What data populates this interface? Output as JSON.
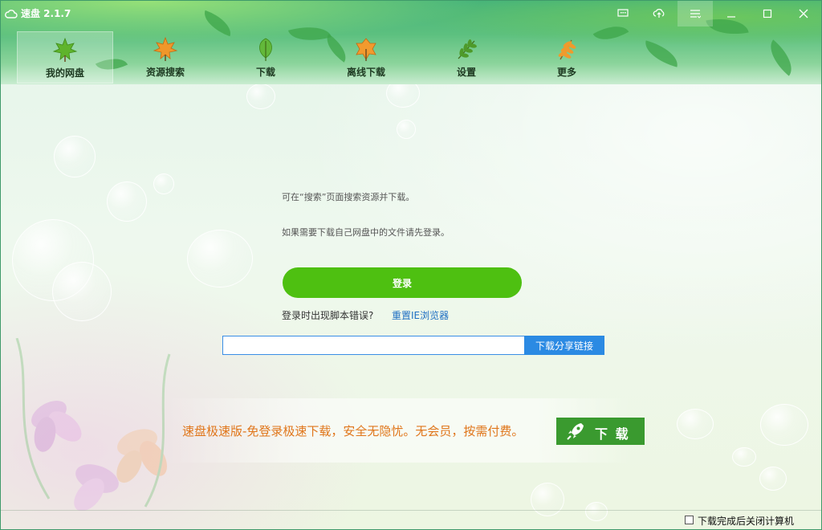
{
  "app": {
    "title": "速盘 2.1.7"
  },
  "window_controls": [
    {
      "name": "feedback-icon"
    },
    {
      "name": "upload-icon"
    },
    {
      "name": "menu-icon"
    },
    {
      "name": "minimize-icon"
    },
    {
      "name": "maximize-icon"
    },
    {
      "name": "close-icon"
    }
  ],
  "nav": {
    "items": [
      {
        "label": "我的网盘",
        "icon": "green-maple-leaf-icon",
        "selected": true
      },
      {
        "label": "资源搜索",
        "icon": "orange-maple-leaf-icon",
        "selected": false
      },
      {
        "label": "下载",
        "icon": "green-leaf-icon",
        "selected": false
      },
      {
        "label": "离线下载",
        "icon": "orange-leaf-icon",
        "selected": false
      },
      {
        "label": "设置",
        "icon": "green-fern-leaf-icon",
        "selected": false
      },
      {
        "label": "更多",
        "icon": "orange-fern-leaf-icon",
        "selected": false
      }
    ]
  },
  "main": {
    "hint1": "可在“搜索”页面搜索资源并下载。",
    "hint2": "如果需要下载自己网盘中的文件请先登录。",
    "login_label": "登录",
    "login_error_text": "登录时出现脚本错误?",
    "reset_ie_label": "重置IE浏览器",
    "link_input_value": "",
    "link_input_placeholder": "",
    "download_share_label": "下载分享链接"
  },
  "promo": {
    "text": "速盘极速版-免登录极速下载，安全无隐忧。无会员，按需付费。",
    "button_label": "下 载",
    "button_icon": "rocket-icon"
  },
  "footer": {
    "shutdown_label": "下载完成后关闭计算机",
    "shutdown_checked": false
  },
  "colors": {
    "accent_green": "#4ec011",
    "link_blue": "#1f6fc3",
    "button_blue": "#2b8ae3",
    "promo_orange": "#e0761b",
    "promo_button_green": "#3a9a2f"
  }
}
